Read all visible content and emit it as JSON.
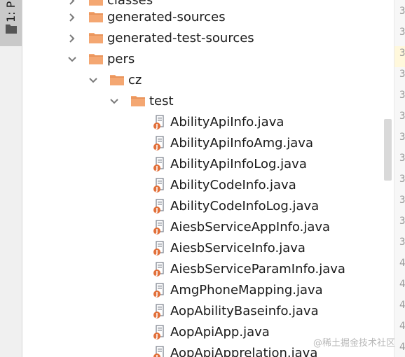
{
  "side_panel": {
    "tab_label": "1: P"
  },
  "tree": {
    "rows": [
      {
        "label": "classes",
        "type": "folder",
        "state": "collapsed"
      },
      {
        "label": "generated-sources",
        "type": "folder",
        "state": "collapsed"
      },
      {
        "label": "generated-test-sources",
        "type": "folder",
        "state": "collapsed"
      },
      {
        "label": "pers",
        "type": "folder",
        "state": "expanded"
      },
      {
        "label": "cz",
        "type": "folder",
        "state": "expanded"
      },
      {
        "label": "test",
        "type": "folder",
        "state": "expanded"
      },
      {
        "label": "AbilityApiInfo.java",
        "type": "java"
      },
      {
        "label": "AbilityApiInfoAmg.java",
        "type": "java"
      },
      {
        "label": "AbilityApiInfoLog.java",
        "type": "java"
      },
      {
        "label": "AbilityCodeInfo.java",
        "type": "java"
      },
      {
        "label": "AbilityCodeInfoLog.java",
        "type": "java"
      },
      {
        "label": "AiesbServiceAppInfo.java",
        "type": "java"
      },
      {
        "label": "AiesbServiceInfo.java",
        "type": "java"
      },
      {
        "label": "AiesbServiceParamInfo.java",
        "type": "java"
      },
      {
        "label": "AmgPhoneMapping.java",
        "type": "java"
      },
      {
        "label": "AopAbilityBaseinfo.java",
        "type": "java"
      },
      {
        "label": "AopApiApp.java",
        "type": "java"
      },
      {
        "label": "AopApiApprelation.java",
        "type": "java"
      }
    ]
  },
  "gutter": {
    "numbers": [
      "3",
      "3",
      "3",
      "3",
      "3",
      "3",
      "3",
      "3",
      "3",
      "3",
      "3",
      "3",
      "4",
      "4",
      "4",
      "4",
      "4"
    ]
  },
  "watermark": "@稀土掘金技术社区",
  "colors": {
    "folder": "#f4a772",
    "folder_dark": "#e8935a",
    "java_badge": "#e2703a",
    "java_page": "#8a9099"
  }
}
